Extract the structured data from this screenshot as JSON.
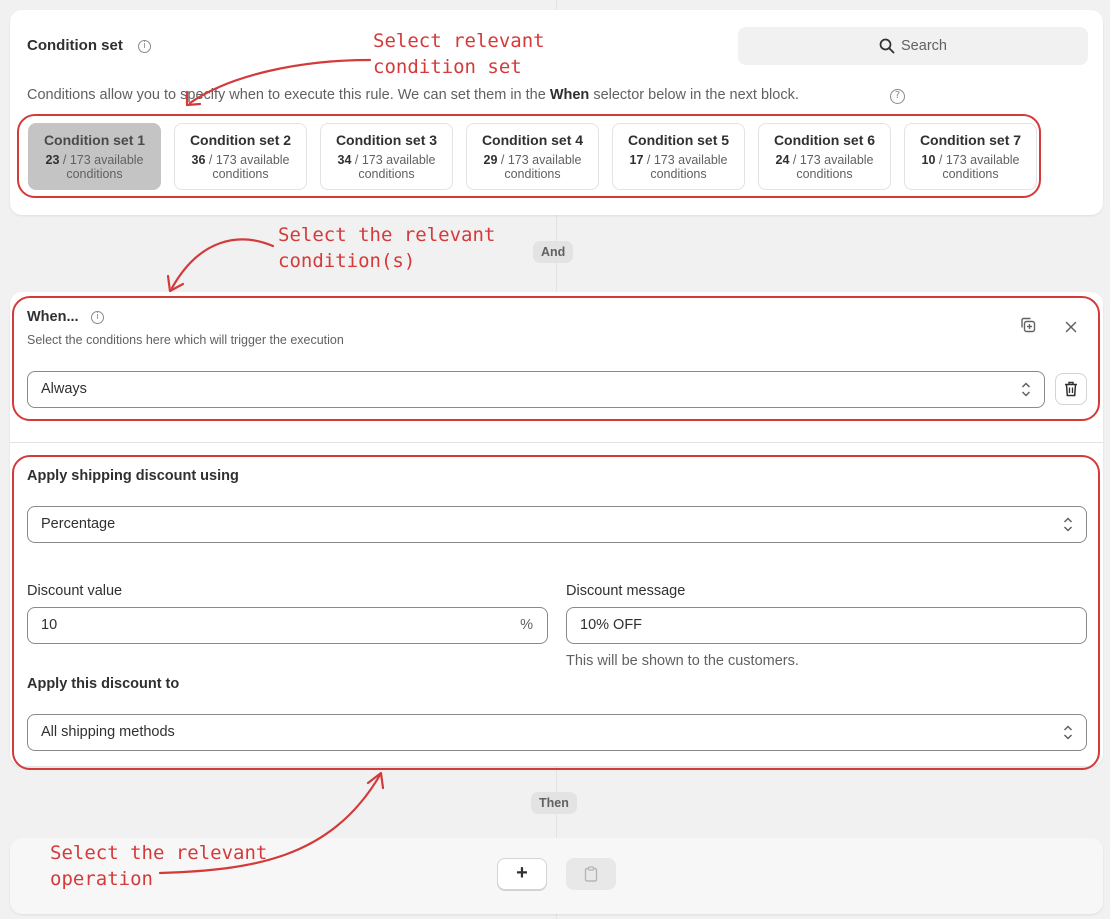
{
  "condition_set": {
    "title": "Condition set",
    "search_label": "Search",
    "description_pre": "Conditions allow you to specify when to execute this rule. We can set them in the ",
    "description_bold": "When",
    "description_post": " selector below in the next block.",
    "sets": [
      {
        "name": "Condition set 1",
        "count": "23",
        "suffix": " / 173 available",
        "line2": "conditions",
        "active": true
      },
      {
        "name": "Condition set 2",
        "count": "36",
        "suffix": " / 173 available",
        "line2": "conditions",
        "active": false
      },
      {
        "name": "Condition set 3",
        "count": "34",
        "suffix": " / 173 available",
        "line2": "conditions",
        "active": false
      },
      {
        "name": "Condition set 4",
        "count": "29",
        "suffix": " / 173 available",
        "line2": "conditions",
        "active": false
      },
      {
        "name": "Condition set 5",
        "count": "17",
        "suffix": " / 173 available",
        "line2": "conditions",
        "active": false
      },
      {
        "name": "Condition set 6",
        "count": "24",
        "suffix": " / 173 available",
        "line2": "conditions",
        "active": false
      },
      {
        "name": "Condition set 7",
        "count": "10",
        "suffix": " / 173 available",
        "line2": "conditions",
        "active": false
      }
    ]
  },
  "connectors": {
    "and": "And",
    "then": "Then"
  },
  "when": {
    "title": "When...",
    "subtitle": "Select the conditions here which will trigger the execution",
    "selected": "Always"
  },
  "action": {
    "apply_label": "Apply shipping discount using",
    "apply_value": "Percentage",
    "discount_value_label": "Discount value",
    "discount_value": "10",
    "discount_suffix": "%",
    "discount_message_label": "Discount message",
    "discount_message": "10% OFF",
    "discount_message_hint": "This will be shown to the customers.",
    "apply_to_label": "Apply this discount to",
    "apply_to_value": "All shipping methods"
  },
  "then_block": {
    "add_label": "+"
  },
  "annotations": {
    "a1": "Select relevant\ncondition set",
    "a2": "Select the relevant\ncondition(s)",
    "a3": "Select the relevant\noperation",
    "color": "#d43a3a"
  }
}
